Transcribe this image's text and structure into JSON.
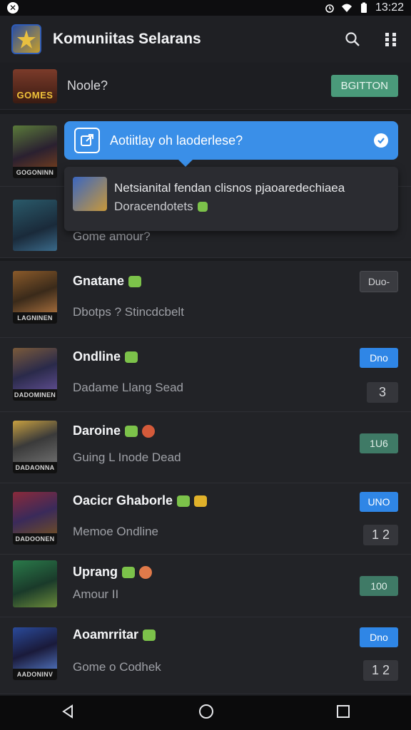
{
  "status_bar": {
    "time": "13:22",
    "left_icon": "x-badge-icon",
    "icons": [
      "alarm-icon",
      "wifi-icon",
      "battery-icon"
    ]
  },
  "app_bar": {
    "title": "Komuniitas Selarans",
    "actions": [
      "search-icon",
      "grid-menu-icon"
    ]
  },
  "top_row": {
    "logo_text": "GOMES",
    "label": "Noole?",
    "button_label": "BGITTON"
  },
  "tooltip": {
    "text": "Aotiitlay oh laoderlese?",
    "icon": "external-link-icon",
    "confirm_icon": "check-circle-icon"
  },
  "popcard": {
    "line1": "Netsianital fendan clisnos pjaoaredechiaea",
    "line2": "Doracendotets"
  },
  "rows": [
    {
      "caption": "GOGONINN",
      "title": "",
      "subtitle": "Gome amour?",
      "badge": "",
      "counter": ""
    },
    {
      "caption": "LAGNINEN",
      "title": "Gnatane",
      "subtitle": "Dbotps ?  Stincdcbelt",
      "badge": "Duo-",
      "counter": ""
    },
    {
      "caption": "DADOMINEN",
      "title": "Ondline",
      "subtitle": "Dadame Llang Sead",
      "badge": "Dno",
      "counter": "3"
    },
    {
      "caption": "DADAONNA",
      "title": "Daroine",
      "subtitle": "Guing L Inode Dead",
      "badge": "1U6",
      "counter": ""
    },
    {
      "caption": "DADOONEN",
      "title": "Oacicr Ghaborle",
      "subtitle": "Memoe Ondline",
      "badge": "UNO",
      "counter": "1 2"
    },
    {
      "caption": "",
      "title": "Uprang",
      "subtitle": "Amour II",
      "badge": "100",
      "counter": ""
    },
    {
      "caption": "AADONINV",
      "title": "Aoamrritar",
      "subtitle": "Gome o Codhek",
      "badge": "Dno",
      "counter": "1 2"
    }
  ],
  "nav_bar": [
    "back-icon",
    "home-icon",
    "recents-icon"
  ],
  "colors": {
    "accent_blue": "#2f86e6",
    "accent_green": "#4a9a7a",
    "chip_green": "#7cc24a",
    "background": "#1a1b1e"
  }
}
